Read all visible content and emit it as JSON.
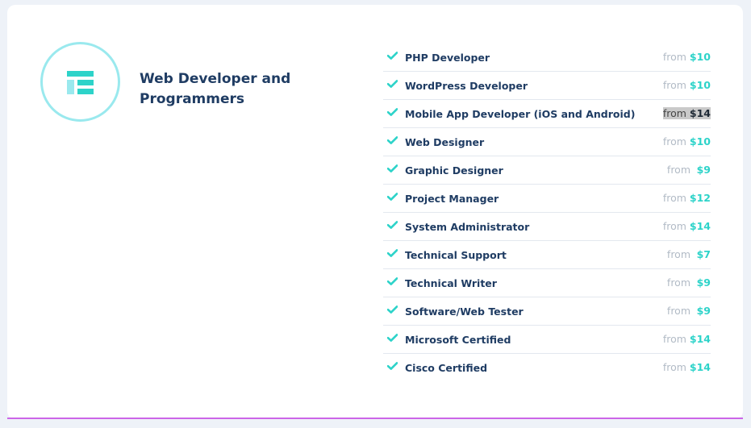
{
  "section": {
    "title": "Web Developer and Programmers",
    "icon": "layout-list-icon"
  },
  "colors": {
    "accent": "#2dd3c9",
    "heading": "#1f3c63",
    "circle": "#9ae9ee",
    "bottom_strip": "#cc66e8"
  },
  "from_label": "from",
  "roles": [
    {
      "name": "PHP Developer",
      "price": "$10"
    },
    {
      "name": "WordPress Developer",
      "price": "$10"
    },
    {
      "name": "Mobile App Developer (iOS and Android)",
      "price": "$14",
      "selected": true
    },
    {
      "name": "Web Designer",
      "price": "$10"
    },
    {
      "name": "Graphic Designer",
      "price": "$9"
    },
    {
      "name": "Project Manager",
      "price": "$12"
    },
    {
      "name": "System Administrator",
      "price": "$14"
    },
    {
      "name": "Technical Support",
      "price": "$7"
    },
    {
      "name": "Technical Writer",
      "price": "$9"
    },
    {
      "name": "Software/Web Tester",
      "price": "$9"
    },
    {
      "name": "Microsoft Certified",
      "price": "$14"
    },
    {
      "name": "Cisco Certified",
      "price": "$14"
    }
  ]
}
